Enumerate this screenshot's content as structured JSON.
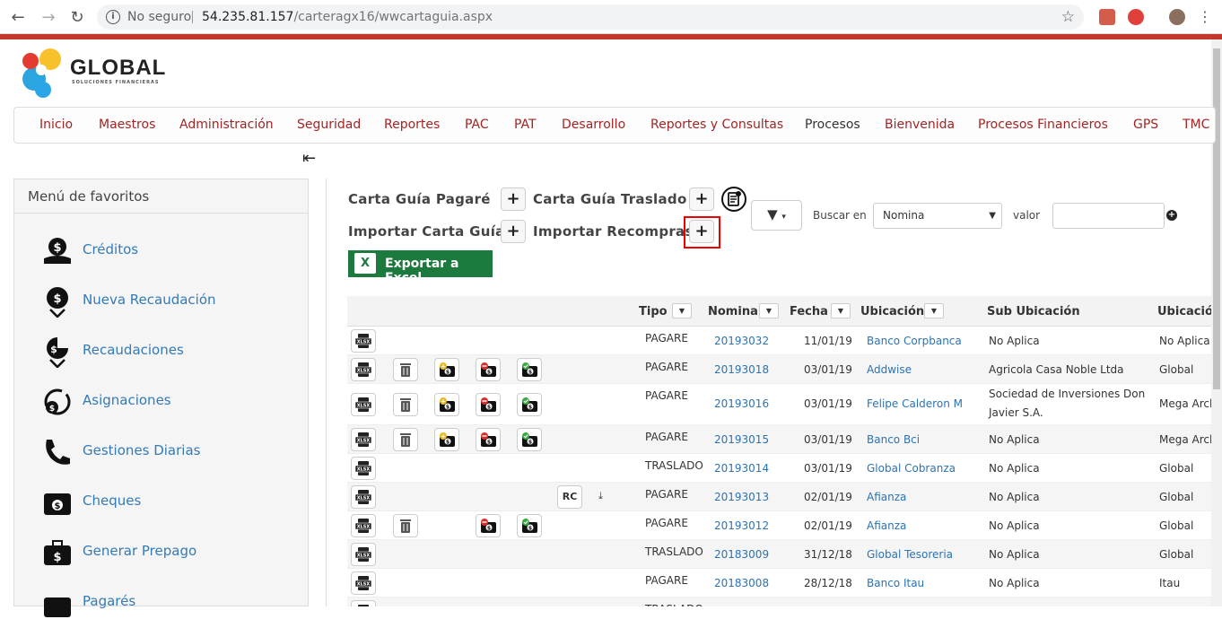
{
  "browser": {
    "security": "No seguro",
    "url_host": "54.235.81.157",
    "url_path": "/carteragx16/wwcartaguia.aspx"
  },
  "logo": {
    "title": "GLOBAL",
    "subtitle": "SOLUCIONES FINANCIERAS"
  },
  "menu": [
    "Inicio",
    "Maestros",
    "Administración",
    "Seguridad",
    "Reportes",
    "PAC",
    "PAT",
    "Desarrollo",
    "Reportes y Consultas",
    "Procesos",
    "Bienvenida",
    "Procesos Financieros",
    "GPS",
    "TMC"
  ],
  "favorites": {
    "title": "Menú de favoritos",
    "items": [
      {
        "label": "Créditos",
        "icon": "money-hand-icon"
      },
      {
        "label": "Nueva Recaudación",
        "icon": "money-down-icon"
      },
      {
        "label": "Recaudaciones",
        "icon": "money-down-icon"
      },
      {
        "label": "Asignaciones",
        "icon": "money-cycle-icon"
      },
      {
        "label": "Gestiones Diarias",
        "icon": "phone-icon"
      },
      {
        "label": "Cheques",
        "icon": "wallet-icon"
      },
      {
        "label": "Generar Prepago",
        "icon": "briefcase-money-icon"
      },
      {
        "label": "Pagarés",
        "icon": "wallet-icon"
      }
    ]
  },
  "operations": {
    "carta_pagare": "Carta Guía Pagaré",
    "carta_traslado": "Carta Guía Traslado",
    "importar_carta": "Importar Carta Guía",
    "importar_recompras": "Importar Recompras",
    "plus": "+",
    "export_excel": "Exportar a Excel",
    "excel_glyph": "X"
  },
  "filter": {
    "buscar_en": "Buscar en",
    "select_value": "Nomina",
    "valor": "valor",
    "add_glyph": "+"
  },
  "grid": {
    "headers": {
      "tipo": "Tipo",
      "nomina": "Nomina",
      "fecha": "Fecha",
      "ubicacion": "Ubicación",
      "sub_ubicacion": "Sub Ubicación",
      "ubicacion2": "Ubicación"
    },
    "rc_label": "RC",
    "rows": [
      {
        "tipo": "PAGARE",
        "nomina": "20193032",
        "fecha": "11/01/19",
        "ubicacion": "Banco Corpbanca",
        "sub": "No Aplica",
        "ubic2": "No Aplica",
        "actions": false,
        "rc": false
      },
      {
        "tipo": "PAGARE",
        "nomina": "20193018",
        "fecha": "03/01/19",
        "ubicacion": "Addwise",
        "sub": "Agricola Casa Noble Ltda",
        "ubic2": "Global",
        "actions": true,
        "rc": false
      },
      {
        "tipo": "PAGARE",
        "nomina": "20193016",
        "fecha": "03/01/19",
        "ubicacion": "Felipe Calderon M",
        "sub": "Sociedad de Inversiones Don",
        "sub2": "Javier S.A.",
        "ubic2": "Mega Arch",
        "actions": true,
        "rc": false
      },
      {
        "tipo": "PAGARE",
        "nomina": "20193015",
        "fecha": "03/01/19",
        "ubicacion": "Banco Bci",
        "sub": "No Aplica",
        "ubic2": "Mega Arch",
        "actions": true,
        "rc": false
      },
      {
        "tipo": "TRASLADO",
        "nomina": "20193014",
        "fecha": "03/01/19",
        "ubicacion": "Global Cobranza",
        "sub": "No Aplica",
        "ubic2": "Global",
        "actions": false,
        "rc": false
      },
      {
        "tipo": "PAGARE",
        "nomina": "20193013",
        "fecha": "02/01/19",
        "ubicacion": "Afianza",
        "sub": "No Aplica",
        "ubic2": "Global",
        "actions": false,
        "rc": true
      },
      {
        "tipo": "PAGARE",
        "nomina": "20193012",
        "fecha": "02/01/19",
        "ubicacion": "Afianza",
        "sub": "No Aplica",
        "ubic2": "Global",
        "actions": "partial",
        "rc": false
      },
      {
        "tipo": "TRASLADO",
        "nomina": "20183009",
        "fecha": "31/12/18",
        "ubicacion": "Global Tesoreria",
        "sub": "No Aplica",
        "ubic2": "Global",
        "actions": false,
        "rc": false
      },
      {
        "tipo": "PAGARE",
        "nomina": "20183008",
        "fecha": "28/12/18",
        "ubicacion": "Banco Itau",
        "sub": "No Aplica",
        "ubic2": "Itau",
        "actions": false,
        "rc": false
      },
      {
        "tipo": "TRASLADO",
        "nomina": "",
        "fecha": "",
        "ubicacion": "",
        "sub": "",
        "ubic2": "",
        "actions": false,
        "rc": false
      }
    ]
  }
}
